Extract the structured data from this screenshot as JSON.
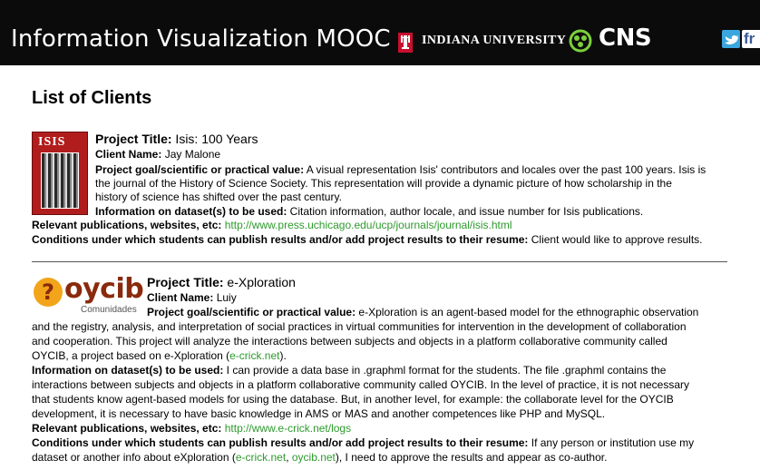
{
  "header": {
    "title": "Information Visualization MOOC",
    "indiana_university": "INDIANA UNIVERSITY",
    "cns": "CNS",
    "social_partial": "fr"
  },
  "heading": "List of Clients",
  "clients": [
    {
      "logo_text": "ISIS",
      "title_label": "Project Title:",
      "title_value": " Isis: 100 Years",
      "client_label": "Client Name:",
      "client_value": " Jay Malone",
      "goal_label": "Project goal/scientific or practical value:",
      "goal_lines": [
        " A visual representation Isis' contributors and locales over the past 100 years. Isis is",
        "the journal of the History of Science Society. This representation will provide a dynamic picture of how scholarship in the",
        "history of science has shifted over the past century."
      ],
      "dataset_label": "Information on dataset(s) to be used:",
      "dataset_lines": [
        " Citation information, author locale, and issue number for Isis publications."
      ],
      "pubs_label": "Relevant publications, websites, etc:",
      "pubs_link": " http://www.press.uchicago.edu/ucp/journals/journal/isis.html",
      "conditions_label": "Conditions under which students can publish results and/or add project results to their resume:",
      "conditions_value": " Client would like to approve results."
    },
    {
      "logo_text": "oycib",
      "logo_glyph": "?",
      "logo_sub": "Comunidades",
      "title_label": "Project Title:",
      "title_value": " e-Xploration",
      "client_label": "Client Name:",
      "client_value": " Luiy",
      "goal_label": "Project goal/scientific or practical value:",
      "goal_first": " e-Xploration is an agent-based model for the ethnographic observation",
      "goal_lines": [
        "and the registry, analysis, and interpretation of social practices in virtual communities for intervention in the development of collaboration",
        "and cooperation. This project will analyze the interactions between subjects and objects in a platform collaborative community called",
        "OYCIB, a project based on e-Xploration ("
      ],
      "goal_link": "e-crick.net",
      "goal_end": ").",
      "dataset_label": "Information on dataset(s) to be used:",
      "dataset_first": " I can provide a data base in .graphml format for the students. The file .graphml contains the",
      "dataset_lines": [
        "interactions between subjects and objects in a platform collaborative community called OYCIB. In the level of practice, it is not necessary",
        "that students know agent-based models for using the database. But, in another level, for example: the collaborate level for the OYCIB",
        "development, it is necessary to have basic knowledge in AMS or MAS and another competences like PHP and MySQL."
      ],
      "pubs_label": "Relevant publications, websites, etc:",
      "pubs_link": " http://www.e-crick.net/logs",
      "conditions_label": "Conditions under which students can publish results and/or add project results to their resume:",
      "conditions_value": " If any person or institution use my",
      "conditions_line2_pre": "dataset or another info about eXploration (",
      "conditions_link1": "e-crick.net",
      "conditions_sep": ", ",
      "conditions_link2": "oycib.net",
      "conditions_line2_post": "), I need to approve the results and appear as co-author."
    }
  ]
}
